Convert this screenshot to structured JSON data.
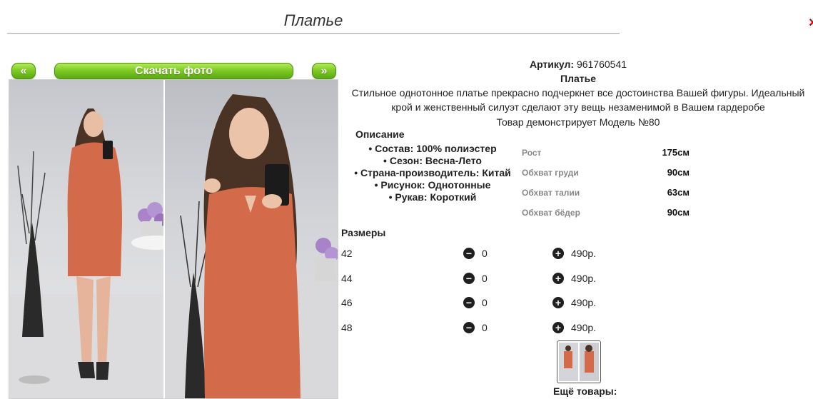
{
  "page": {
    "title": "Платье"
  },
  "gallery": {
    "prev_label": "«",
    "download_label": "Скачать фото",
    "next_label": "»",
    "accent": "#7fcb26"
  },
  "product": {
    "article_label": "Артикул:",
    "article_value": "961760541",
    "name": "Платье",
    "description_line1": "Стильное однотонное платье прекрасно подчеркнет все достоинства Вашей фигуры. Идеальный",
    "description_line2": "крой и женственный силуэт сделают эту вещь незаменимой в Вашем гардеробе",
    "model_note": "Товар демонстрирует Модель №80"
  },
  "description": {
    "heading": "Описание",
    "items": [
      "Состав: 100% полиэстер",
      "Сезон: Весна-Лето",
      "Страна-производитель: Китай",
      "Рисунок: Однотонные",
      "Рукав: Короткий"
    ]
  },
  "measurements": [
    {
      "label": "Рост",
      "value": "175см"
    },
    {
      "label": "Обхват груди",
      "value": "90см"
    },
    {
      "label": "Обхват талии",
      "value": "63см"
    },
    {
      "label": "Обхват бёдер",
      "value": "90см"
    }
  ],
  "sizes": {
    "heading": "Размеры",
    "rows": [
      {
        "size": "42",
        "qty": "0",
        "price": "490р."
      },
      {
        "size": "44",
        "qty": "0",
        "price": "490р."
      },
      {
        "size": "46",
        "qty": "0",
        "price": "490р."
      },
      {
        "size": "48",
        "qty": "0",
        "price": "490р."
      }
    ]
  },
  "more": {
    "label": "Ещё товары:"
  },
  "icons": {
    "minus": "minus-circle-icon",
    "plus": "plus-circle-icon"
  }
}
